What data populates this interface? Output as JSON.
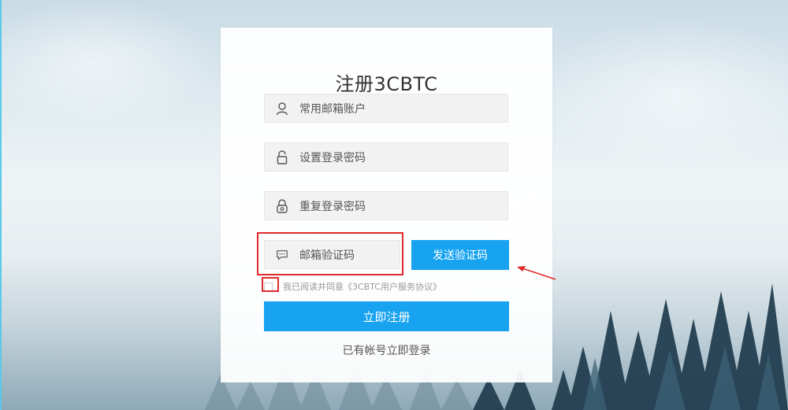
{
  "form": {
    "title": "注册3CBTC",
    "email_placeholder": "常用邮箱账户",
    "password_placeholder": "设置登录密码",
    "repeat_password_placeholder": "重复登录密码",
    "code_placeholder": "邮箱验证码",
    "send_code_label": "发送验证码",
    "agreement_text": "我已阅读并同意《3CBTC用户服务协议》",
    "register_label": "立即注册",
    "login_link_label": "已有帐号立即登录"
  },
  "colors": {
    "accent": "#17a3f0",
    "annotation": "#e02a2a"
  },
  "icons": {
    "email": "user-icon",
    "password": "lock-icon",
    "repeat_password": "lock-dots-icon",
    "code": "chat-icon"
  }
}
